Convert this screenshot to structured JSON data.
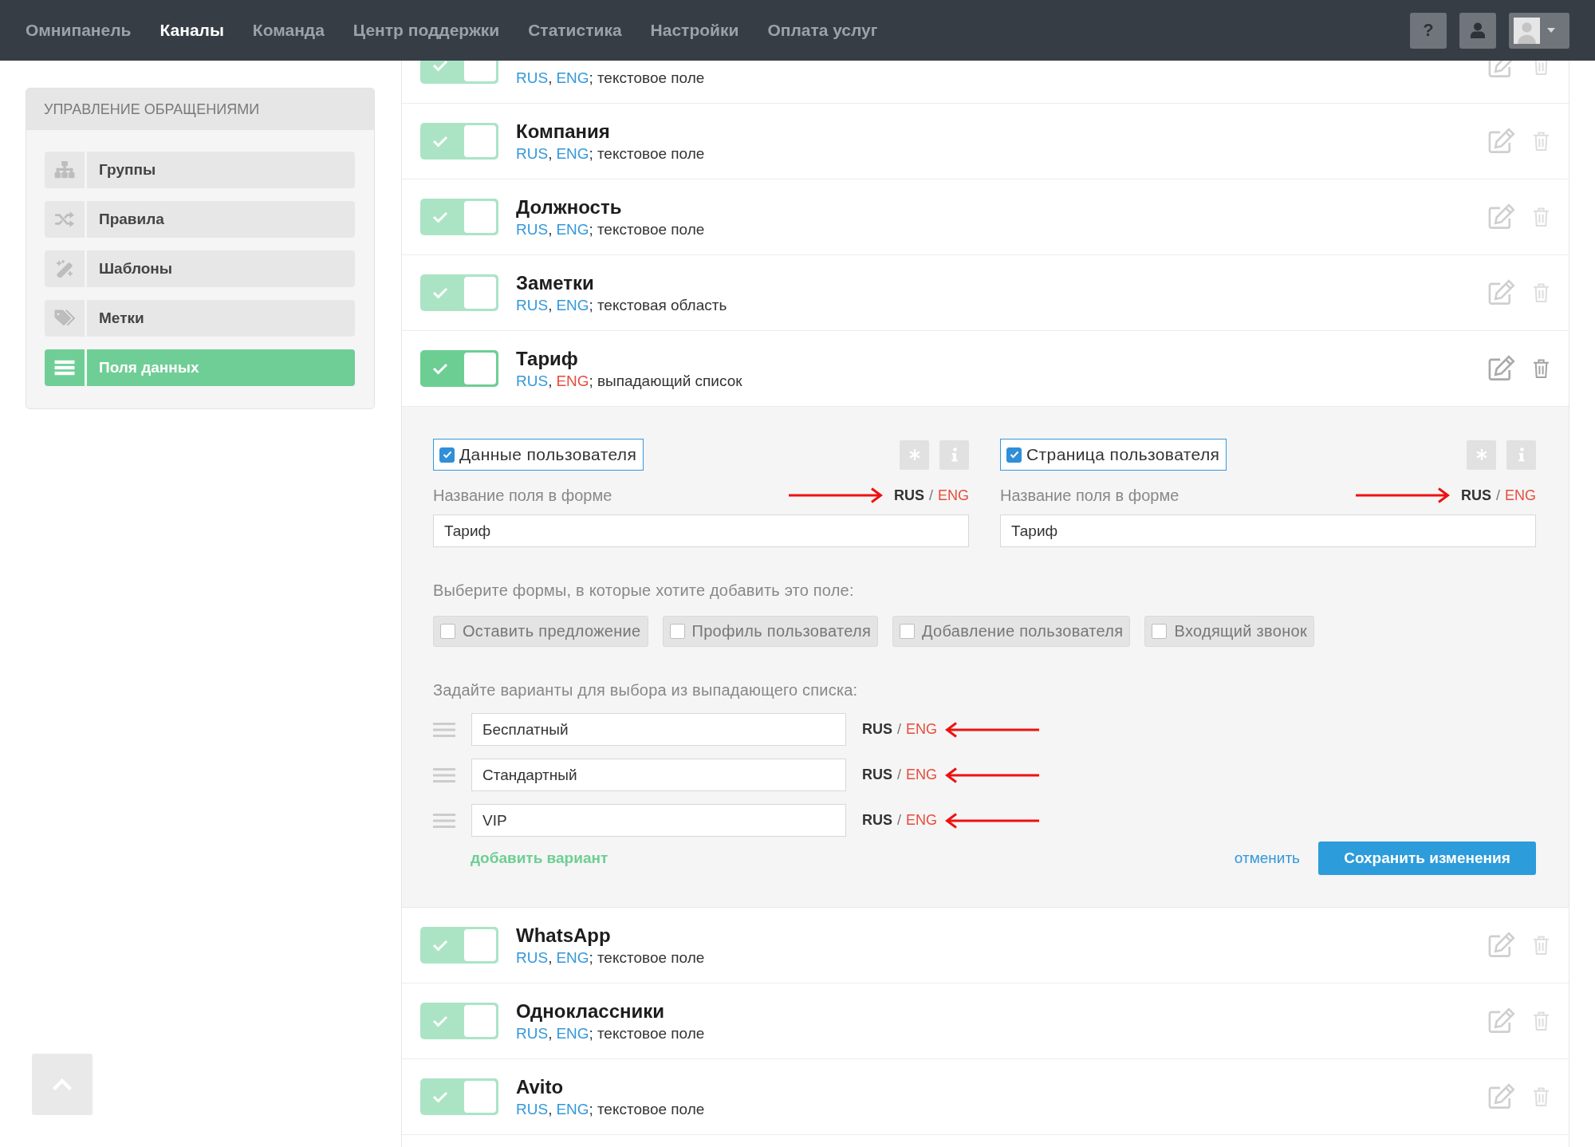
{
  "topbar": {
    "nav": [
      {
        "label": "Омнипанель",
        "selected": false
      },
      {
        "label": "Каналы",
        "selected": true
      },
      {
        "label": "Команда",
        "selected": false
      },
      {
        "label": "Центр поддержки",
        "selected": false
      },
      {
        "label": "Статистика",
        "selected": false
      },
      {
        "label": "Настройки",
        "selected": false
      },
      {
        "label": "Оплата услуг",
        "selected": false
      }
    ],
    "help": "?"
  },
  "sidebar": {
    "title": "УПРАВЛЕНИЕ ОБРАЩЕНИЯМИ",
    "items": [
      {
        "label": "Группы",
        "selected": false
      },
      {
        "label": "Правила",
        "selected": false
      },
      {
        "label": "Шаблоны",
        "selected": false
      },
      {
        "label": "Метки",
        "selected": false
      },
      {
        "label": "Поля данных",
        "selected": true
      }
    ]
  },
  "fields": [
    {
      "on": true,
      "expanded": false,
      "langs": [
        {
          "label": "RUS",
          "color": "#3498db",
          "after": ","
        },
        {
          "label": "ENG",
          "color": "#3498db",
          "after": ";"
        }
      ],
      "type": "текстовое поле"
    },
    {
      "title": "Компания",
      "on": true,
      "expanded": false,
      "langs": [
        {
          "label": "RUS",
          "color": "#3498db",
          "after": ","
        },
        {
          "label": "ENG",
          "color": "#3498db",
          "after": ";"
        }
      ],
      "type": "текстовое поле"
    },
    {
      "title": "Должность",
      "on": true,
      "expanded": false,
      "langs": [
        {
          "label": "RUS",
          "color": "#3498db",
          "after": ","
        },
        {
          "label": "ENG",
          "color": "#3498db",
          "after": ";"
        }
      ],
      "type": "текстовое поле"
    },
    {
      "title": "Заметки",
      "on": true,
      "expanded": false,
      "langs": [
        {
          "label": "RUS",
          "color": "#3498db",
          "after": ","
        },
        {
          "label": "ENG",
          "color": "#3498db",
          "after": ";"
        }
      ],
      "type": "текстовая область"
    },
    {
      "title": "Тариф",
      "on": true,
      "expanded": true,
      "langs": [
        {
          "label": "RUS",
          "color": "#3498db",
          "after": ","
        },
        {
          "label": "ENG",
          "color": "#e74c3c",
          "after": ";"
        }
      ],
      "type": "выпадающий список",
      "editor": {
        "columns": [
          {
            "option": {
              "label": "Данные пользователя",
              "checked": true
            },
            "field_label": "Название поля в форме",
            "langs": [
              {
                "label": "RUS",
                "selected": true,
                "color": "#333333",
                "after": "/"
              },
              {
                "label": "ENG",
                "selected": false,
                "color": "#e74c3c"
              }
            ],
            "value": "Тариф"
          },
          {
            "option": {
              "label": "Страница пользователя",
              "checked": true
            },
            "field_label": "Название поля в форме",
            "langs": [
              {
                "label": "RUS",
                "selected": true,
                "color": "#333333",
                "after": "/"
              },
              {
                "label": "ENG",
                "selected": false,
                "color": "#e74c3c"
              }
            ],
            "value": "Тариф"
          }
        ],
        "forms_prompt": "Выберите формы, в которые хотите добавить это поле:",
        "forms": [
          {
            "label": "Оставить предложение",
            "checked": false
          },
          {
            "label": "Профиль пользователя",
            "checked": false
          },
          {
            "label": "Добавление пользователя",
            "checked": false
          },
          {
            "label": "Входящий звонок",
            "checked": false
          }
        ],
        "options_prompt": "Задайте варианты для выбора из выпадающего списка:",
        "options": [
          {
            "value": "Бесплатный",
            "langs": [
              {
                "label": "RUS",
                "selected": true,
                "color": "#333333",
                "after": "/"
              },
              {
                "label": "ENG",
                "selected": false,
                "color": "#e74c3c"
              }
            ]
          },
          {
            "value": "Стандартный",
            "langs": [
              {
                "label": "RUS",
                "selected": true,
                "color": "#333333",
                "after": "/"
              },
              {
                "label": "ENG",
                "selected": false,
                "color": "#e74c3c"
              }
            ]
          },
          {
            "value": "VIP",
            "langs": [
              {
                "label": "RUS",
                "selected": true,
                "color": "#333333",
                "after": "/"
              },
              {
                "label": "ENG",
                "selected": false,
                "color": "#e74c3c"
              }
            ]
          }
        ],
        "add_option": "добавить вариант",
        "cancel": "отменить",
        "save": "Сохранить изменения"
      }
    },
    {
      "title": "WhatsApp",
      "on": true,
      "expanded": false,
      "langs": [
        {
          "label": "RUS",
          "color": "#3498db",
          "after": ","
        },
        {
          "label": "ENG",
          "color": "#3498db",
          "after": ";"
        }
      ],
      "type": "текстовое поле"
    },
    {
      "title": "Одноклассники",
      "on": true,
      "expanded": false,
      "langs": [
        {
          "label": "RUS",
          "color": "#3498db",
          "after": ","
        },
        {
          "label": "ENG",
          "color": "#3498db",
          "after": ";"
        }
      ],
      "type": "текстовое поле"
    },
    {
      "title": "Avito",
      "on": true,
      "expanded": false,
      "langs": [
        {
          "label": "RUS",
          "color": "#3498db",
          "after": ","
        },
        {
          "label": "ENG",
          "color": "#3498db",
          "after": ";"
        }
      ],
      "type": "текстовое поле"
    }
  ]
}
